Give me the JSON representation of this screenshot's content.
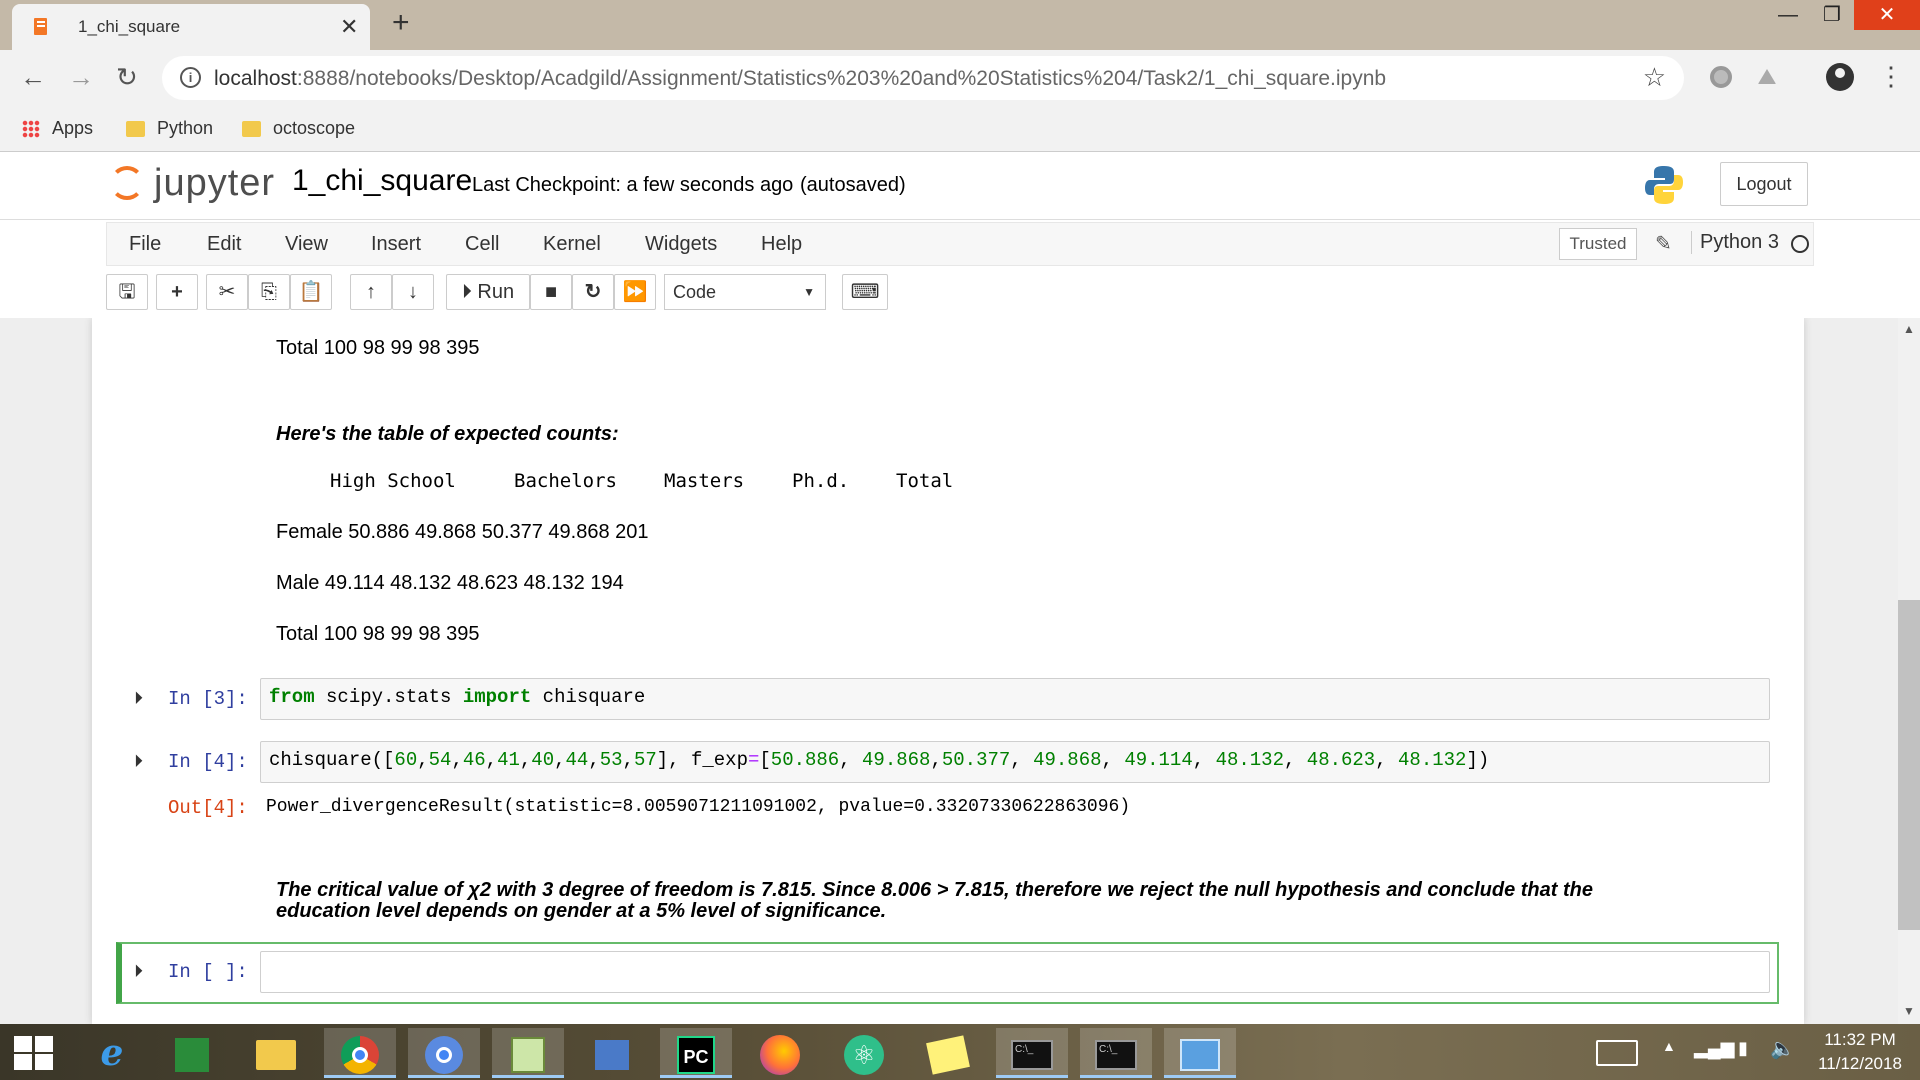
{
  "browser": {
    "tab_title": "1_chi_square",
    "tab_close": "✕",
    "new_tab": "+",
    "url_host": "localhost",
    "url_path": ":8888/notebooks/Desktop/Acadgild/Assignment/Statistics%203%20and%20Statistics%204/Task2/1_chi_square.ipynb",
    "bookmarks": [
      "Apps",
      "Python",
      "octoscope"
    ]
  },
  "jupyter": {
    "logo_text": "jupyter",
    "notebook_name": "1_chi_square",
    "checkpoint": "Last Checkpoint: a few seconds ago",
    "autosave": "(autosaved)",
    "logout": "Logout",
    "menu": [
      "File",
      "Edit",
      "View",
      "Insert",
      "Cell",
      "Kernel",
      "Widgets",
      "Help"
    ],
    "trusted": "Trusted",
    "kernel": "Python 3",
    "run_label": "Run",
    "cell_type": "Code"
  },
  "notebook": {
    "total_line_top": "Total 100 98 99 98 395",
    "expected_heading": "Here's the table of expected counts:",
    "expected_header_cols": [
      "High School",
      "Bachelors",
      "Masters",
      "Ph.d.",
      "Total"
    ],
    "female_row": "Female 50.886 49.868 50.377 49.868 201",
    "male_row": "Male 49.114 48.132 48.623 48.132 194",
    "total_row": "Total 100 98 99 98 395",
    "cell3_prompt": "In [3]:",
    "cell3_kw1": "from",
    "cell3_mod": " scipy.stats ",
    "cell3_kw2": "import",
    "cell3_name": " chisquare",
    "cell4_prompt": "In [4]:",
    "cell4_out_prompt": "Out[4]:",
    "cell4_output": "Power_divergenceResult(statistic=8.0059071211091002, pvalue=0.33207330622863096)",
    "conclusion_line1": "The critical value of χ2 with 3 degree of freedom is 7.815. Since 8.006 > 7.815, therefore we reject the null hypothesis and conclude that the",
    "conclusion_line2": "education level depends on gender at a 5% level of significance.",
    "empty_prompt": "In [ ]:"
  },
  "taskbar": {
    "time": "11:32 PM",
    "date": "11/12/2018"
  }
}
